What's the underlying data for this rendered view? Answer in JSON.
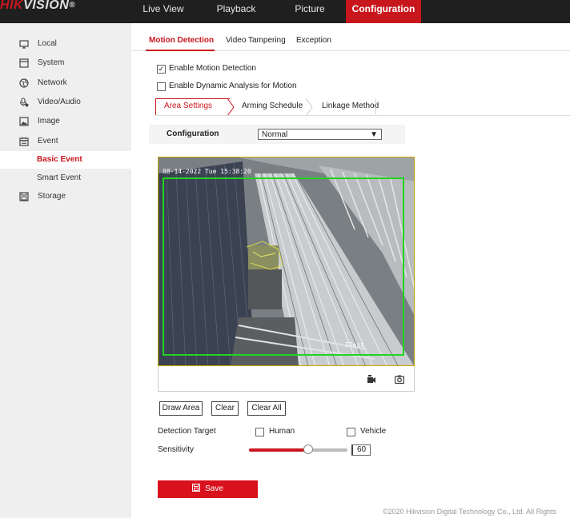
{
  "logo": {
    "part1": "HIK",
    "part2": "VISION",
    "reg": "®"
  },
  "topnav": [
    {
      "label": "Live View"
    },
    {
      "label": "Playback"
    },
    {
      "label": "Picture"
    },
    {
      "label": "Configuration"
    }
  ],
  "sidebar": {
    "items": [
      {
        "label": "Local",
        "icon": "monitor-icon"
      },
      {
        "label": "System",
        "icon": "system-icon"
      },
      {
        "label": "Network",
        "icon": "globe-icon"
      },
      {
        "label": "Video/Audio",
        "icon": "microphone-icon"
      },
      {
        "label": "Image",
        "icon": "image-icon"
      },
      {
        "label": "Event",
        "icon": "calendar-icon"
      },
      {
        "label": "Basic Event"
      },
      {
        "label": "Smart Event"
      },
      {
        "label": "Storage",
        "icon": "floppy-icon"
      }
    ]
  },
  "tabs": [
    {
      "label": "Motion Detection"
    },
    {
      "label": "Video Tampering"
    },
    {
      "label": "Exception"
    }
  ],
  "options": {
    "enable_motion": {
      "label": "Enable Motion Detection",
      "checked": true
    },
    "enable_dynamic": {
      "label": "Enable Dynamic Analysis for Motion",
      "checked": false
    }
  },
  "subtabs": [
    {
      "label": "Area Settings"
    },
    {
      "label": "Arming Schedule"
    },
    {
      "label": "Linkage Method"
    }
  ],
  "config": {
    "label": "Configuration",
    "value": "Normal"
  },
  "video": {
    "osd": "08-14-2022 Tue 15:38:20",
    "channel_label": "ITest"
  },
  "buttons": {
    "draw_area": "Draw Area",
    "clear": "Clear",
    "clear_all": "Clear All",
    "save": "Save"
  },
  "detection": {
    "label": "Detection Target",
    "human": {
      "label": "Human",
      "checked": false
    },
    "vehicle": {
      "label": "Vehicle",
      "checked": false
    }
  },
  "sensitivity": {
    "label": "Sensitivity",
    "value": "60",
    "fraction": 0.6
  },
  "footer": {
    "copyright": "©2020 Hikvision Digital Technology Co., Ltd. All Rights"
  },
  "colors": {
    "accent": "#c8161d",
    "topbar": "#1f1f1f",
    "sidebar": "#efefef",
    "motion_area": "#22d322"
  }
}
